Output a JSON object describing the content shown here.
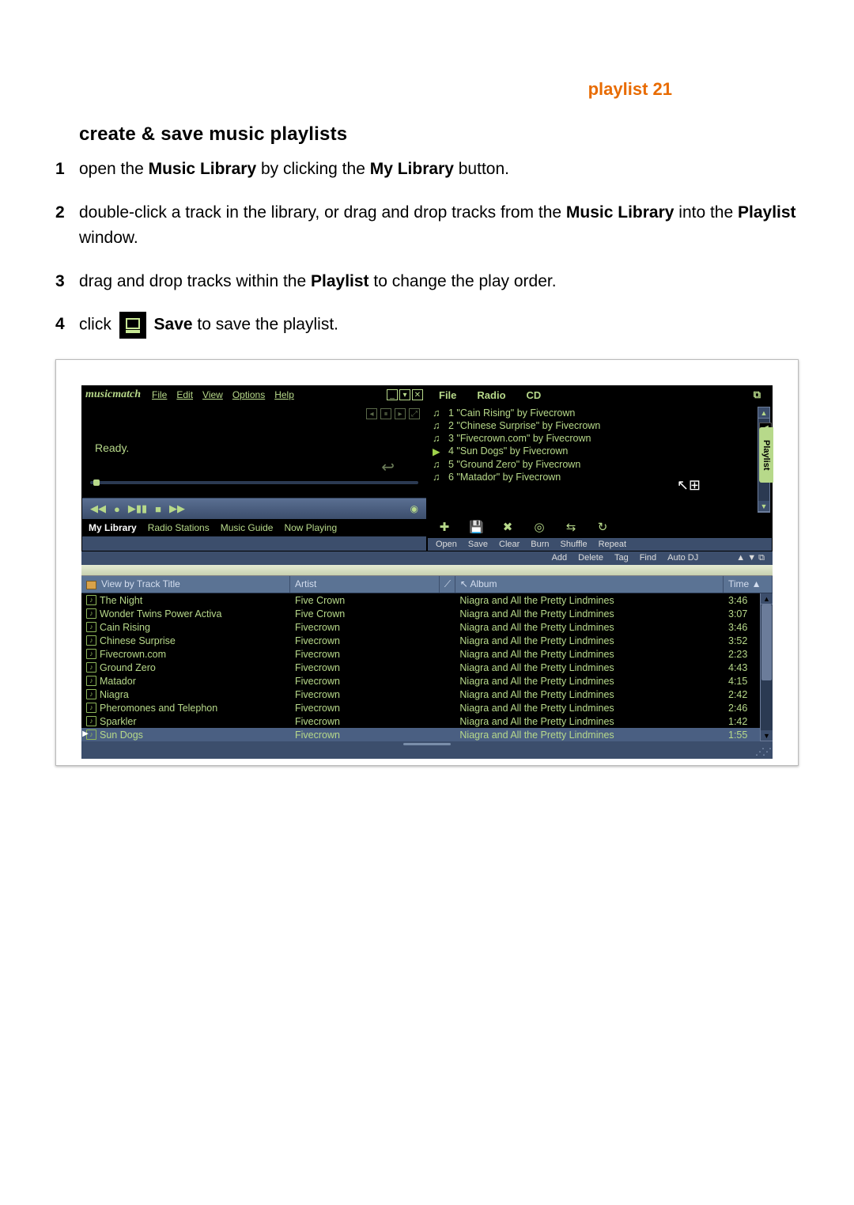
{
  "header": {
    "tag": "playlist 21"
  },
  "section": {
    "title": "create & save music playlists"
  },
  "steps": [
    {
      "num": "1",
      "t0": "open the ",
      "b0": "Music Library",
      "t1": " by clicking the ",
      "b1": "My Library",
      "t2": " button."
    },
    {
      "num": "2",
      "t0": "double-click a track in the library, or drag and drop tracks from the ",
      "b0": "Music Library",
      "t1": " into the ",
      "b1": "Playlist",
      "t2": " window."
    },
    {
      "num": "3",
      "t0": "drag and drop tracks within the ",
      "b0": "Playlist",
      "t1": " to change the play order.",
      "b1": "",
      "t2": ""
    },
    {
      "num": "4",
      "t0": "click ",
      "b0": "",
      "t1": "",
      "b1": "Save",
      "t2": " to save the playlist.",
      "icon": true
    }
  ],
  "app": {
    "logo": "musicmatch",
    "menus": [
      "File",
      "Edit",
      "View",
      "Options",
      "Help"
    ],
    "winbtns": [
      "_",
      "▾",
      "✕"
    ],
    "player": {
      "status": "Ready.",
      "miniControls": [
        "◂",
        "⏸",
        "▸",
        "⤢"
      ]
    },
    "transport": [
      "◀◀",
      "●",
      "▶▮▮",
      "■",
      "▶▶"
    ],
    "leftTabs": [
      "My Library",
      "Radio Stations",
      "Music Guide",
      "Now Playing"
    ],
    "rightMenus": [
      "File",
      "Radio",
      "CD"
    ],
    "playlist": [
      {
        "n": "1",
        "t": "\"Cain Rising\" by Fivecrown"
      },
      {
        "n": "2",
        "t": "\"Chinese Surprise\" by Fivecrown"
      },
      {
        "n": "3",
        "t": "\"Fivecrown.com\" by Fivecrown"
      },
      {
        "n": "4",
        "t": "\"Sun Dogs\" by Fivecrown",
        "playing": true
      },
      {
        "n": "5",
        "t": "\"Ground Zero\" by Fivecrown"
      },
      {
        "n": "6",
        "t": "\"Matador\" by Fivecrown"
      }
    ],
    "sideTab": "Playlist",
    "iconbarLabelsTop": [
      "Open",
      "Save",
      "Clear",
      "Burn",
      "Shuffle",
      "Repeat"
    ],
    "iconbarGlyphs": [
      "✚",
      "💾",
      "✖",
      "◎",
      "⇆",
      "↻"
    ],
    "iconbarLabelsBottom": [
      "Add",
      "Delete",
      "Tag",
      "Find",
      "Auto DJ"
    ],
    "library": {
      "headers": {
        "title": "View by Track Title",
        "artist": "Artist",
        "album": "Album",
        "time": "Time"
      },
      "rows": [
        {
          "title": "The Night",
          "artist": "Five Crown",
          "album": "Niagra and All the Pretty Lindmines",
          "time": "3:46"
        },
        {
          "title": "Wonder Twins Power Activa",
          "artist": "Five Crown",
          "album": "Niagra and All the Pretty Lindmines",
          "time": "3:07"
        },
        {
          "title": "Cain Rising",
          "artist": "Fivecrown",
          "album": "Niagra and All the Pretty Lindmines",
          "time": "3:46"
        },
        {
          "title": "Chinese Surprise",
          "artist": "Fivecrown",
          "album": "Niagra and All the Pretty Lindmines",
          "time": "3:52"
        },
        {
          "title": "Fivecrown.com",
          "artist": "Fivecrown",
          "album": "Niagra and All the Pretty Lindmines",
          "time": "2:23"
        },
        {
          "title": "Ground Zero",
          "artist": "Fivecrown",
          "album": "Niagra and All the Pretty Lindmines",
          "time": "4:43"
        },
        {
          "title": "Matador",
          "artist": "Fivecrown",
          "album": "Niagra and All the Pretty Lindmines",
          "time": "4:15"
        },
        {
          "title": "Niagra",
          "artist": "Fivecrown",
          "album": "Niagra and All the Pretty Lindmines",
          "time": "2:42"
        },
        {
          "title": "Pheromones and Telephon",
          "artist": "Fivecrown",
          "album": "Niagra and All the Pretty Lindmines",
          "time": "2:46"
        },
        {
          "title": "Sparkler",
          "artist": "Fivecrown",
          "album": "Niagra and All the Pretty Lindmines",
          "time": "1:42"
        },
        {
          "title": "Sun Dogs",
          "artist": "Fivecrown",
          "album": "Niagra and All the Pretty Lindmines",
          "time": "1:55",
          "selected": true
        }
      ]
    }
  }
}
